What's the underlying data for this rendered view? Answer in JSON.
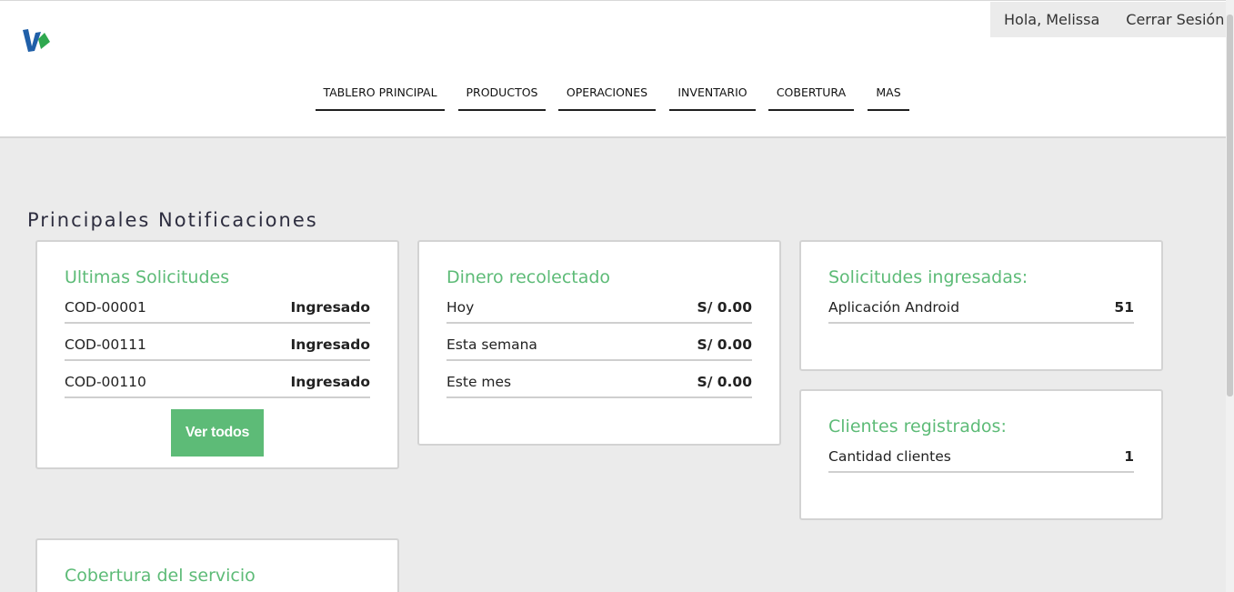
{
  "user": {
    "greeting": "Hola, Melissa",
    "logout_label": "Cerrar Sesión"
  },
  "nav": {
    "items": [
      {
        "label": "TABLERO PRINCIPAL"
      },
      {
        "label": "PRODUCTOS"
      },
      {
        "label": "OPERACIONES"
      },
      {
        "label": "INVENTARIO"
      },
      {
        "label": "COBERTURA"
      },
      {
        "label": "MAS"
      }
    ]
  },
  "colors": {
    "accent": "#5dbb77",
    "background": "#ebebeb",
    "logo_blue": "#1f5fa8",
    "logo_green": "#2fa84f"
  },
  "icons": {
    "logo": "brand-logo-icon"
  },
  "main": {
    "section_title": "Principales Notificaciones",
    "cards": {
      "ultimas": {
        "title": "Ultimas Solicitudes",
        "rows": [
          {
            "key": "COD-00001",
            "value": "Ingresado"
          },
          {
            "key": "COD-00111",
            "value": "Ingresado"
          },
          {
            "key": "COD-00110",
            "value": "Ingresado"
          }
        ],
        "button_label": "Ver todos"
      },
      "dinero": {
        "title": "Dinero recolectado",
        "rows": [
          {
            "key": "Hoy",
            "value": "S/ 0.00"
          },
          {
            "key": "Esta semana",
            "value": "S/ 0.00"
          },
          {
            "key": "Este mes",
            "value": "S/ 0.00"
          }
        ]
      },
      "solicitudes": {
        "title": "Solicitudes ingresadas:",
        "rows": [
          {
            "key": "Aplicación Android",
            "value": "51"
          }
        ]
      },
      "clientes": {
        "title": "Clientes registrados:",
        "rows": [
          {
            "key": "Cantidad clientes",
            "value": "1"
          }
        ]
      },
      "cobertura": {
        "title": "Cobertura del servicio"
      }
    }
  }
}
